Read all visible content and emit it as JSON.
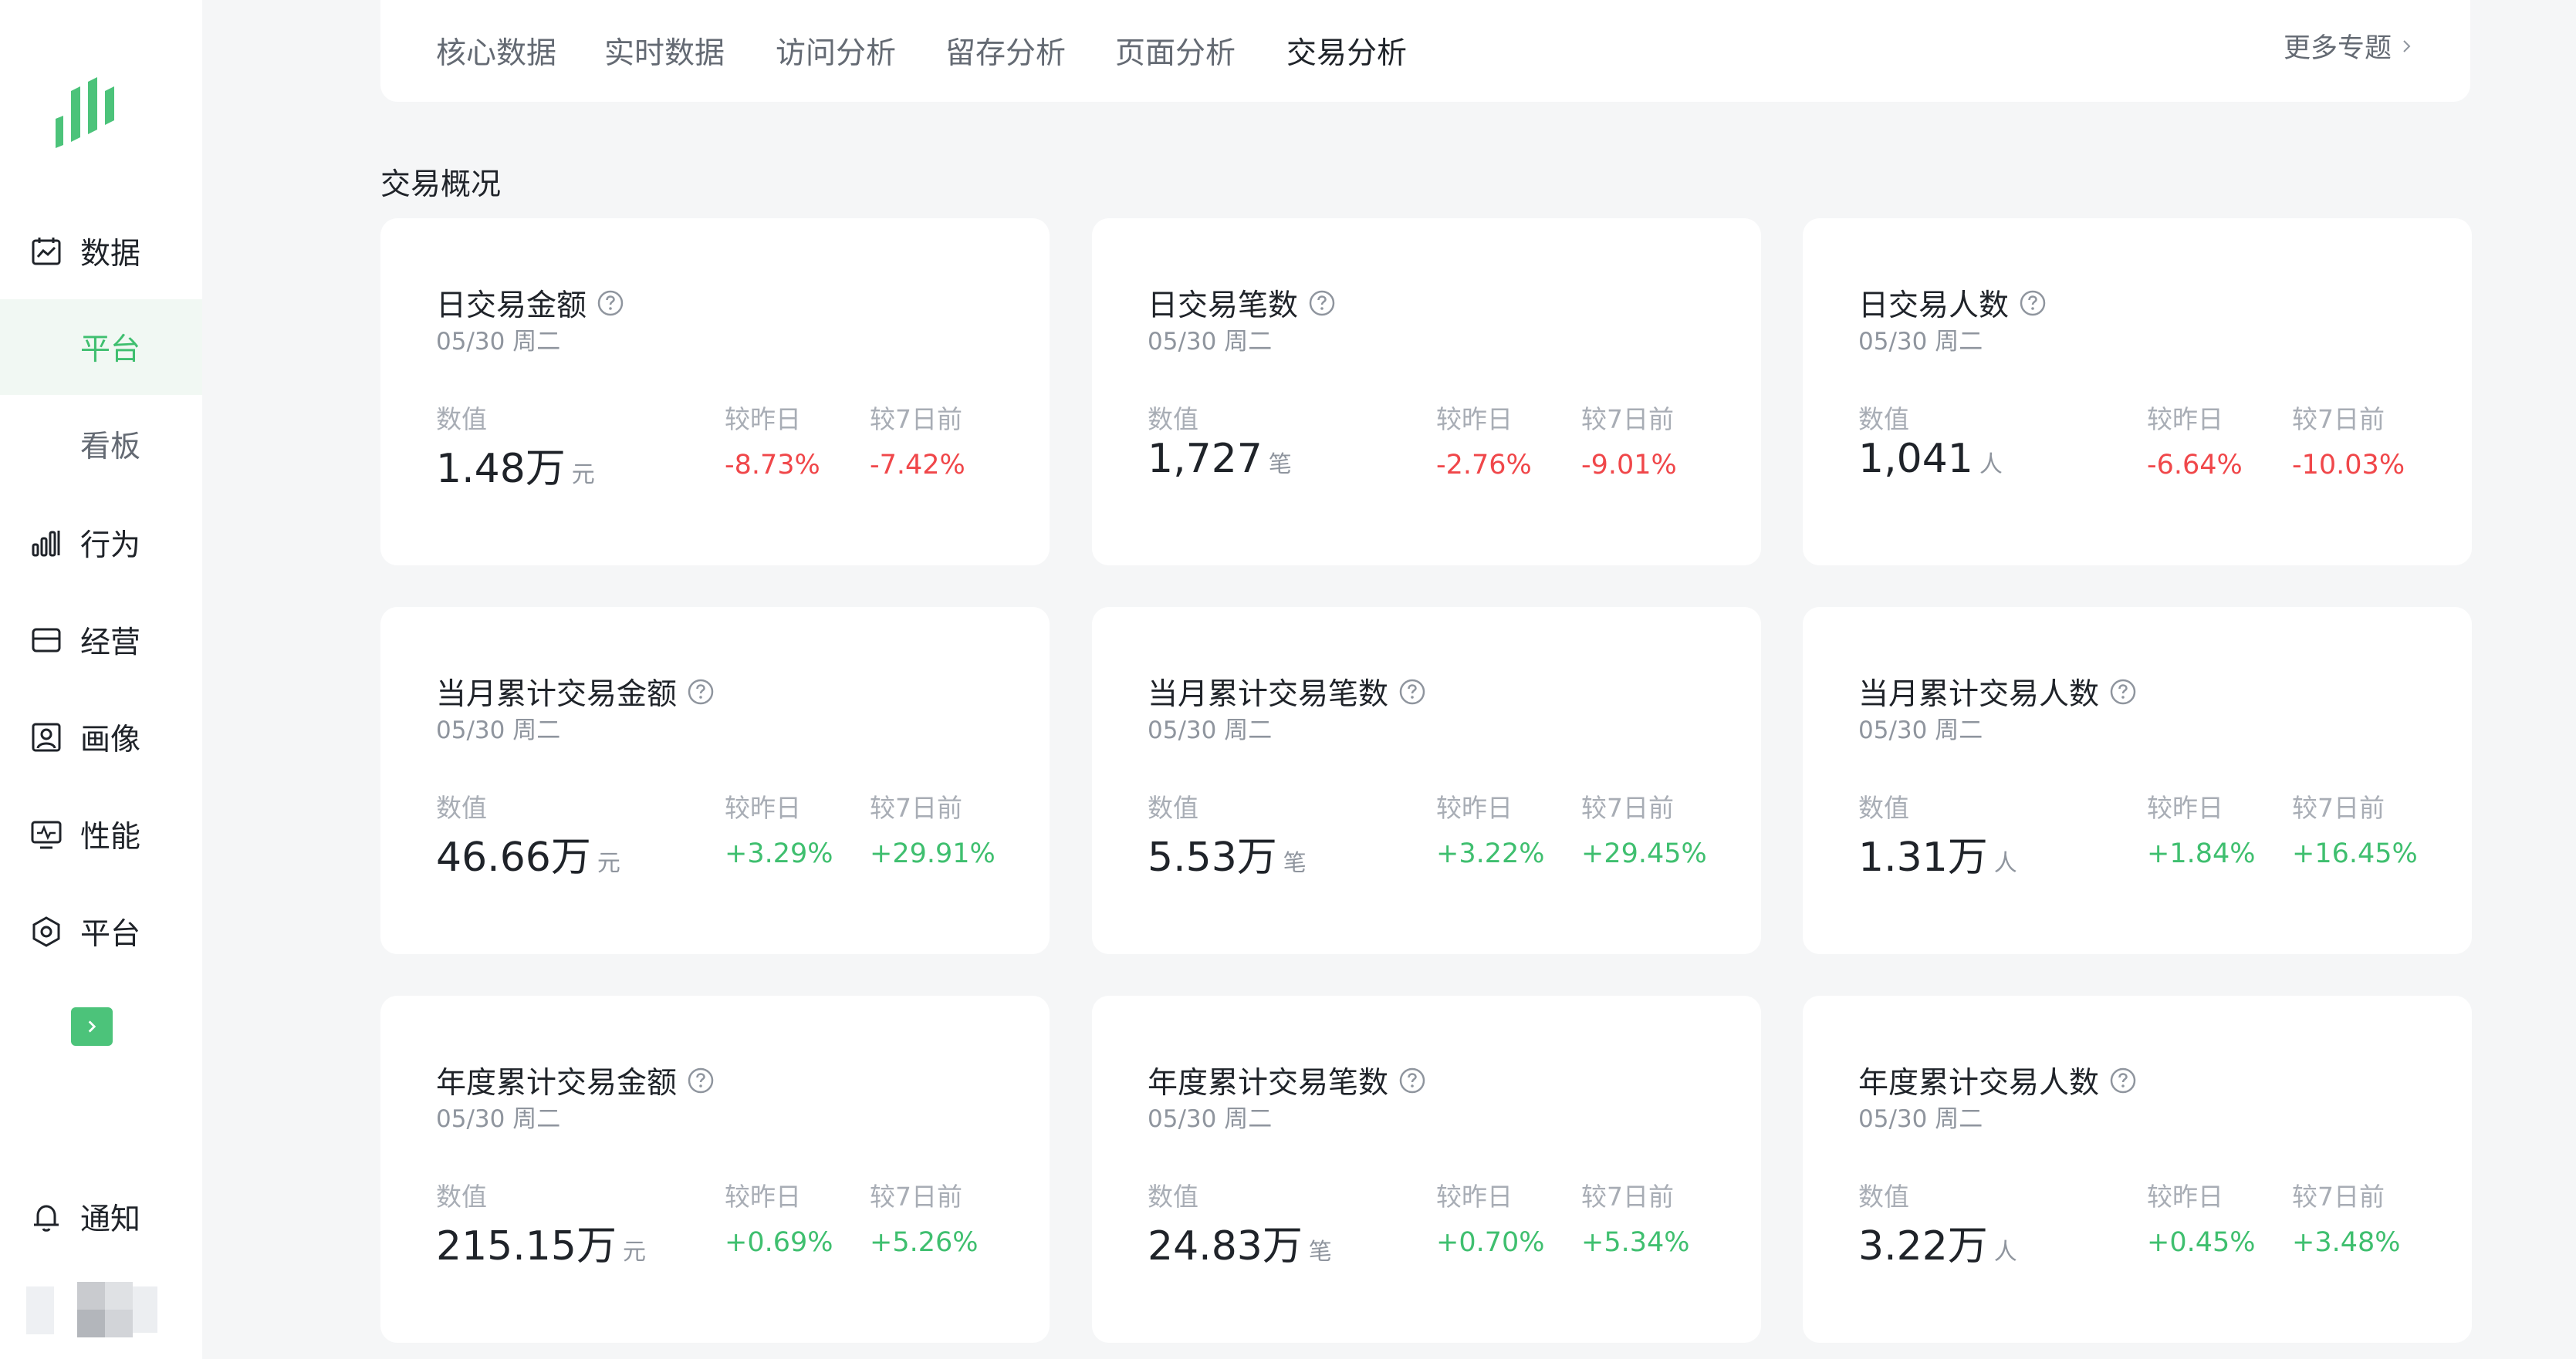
{
  "sidebar": {
    "sections": [
      {
        "icon": "calendar-chart-icon",
        "label": "数据"
      },
      {
        "icon": "bar-chart-icon",
        "label": "行为"
      },
      {
        "icon": "store-icon",
        "label": "经营"
      },
      {
        "icon": "portrait-icon",
        "label": "画像"
      },
      {
        "icon": "monitor-pulse-icon",
        "label": "性能"
      },
      {
        "icon": "hexagon-icon",
        "label": "平台"
      }
    ],
    "sub_items": [
      {
        "label": "平台",
        "active": true
      },
      {
        "label": "看板",
        "active": false
      }
    ],
    "notifications_label": "通知",
    "accent_color": "#3fbf6f"
  },
  "tabs": [
    {
      "label": "核心数据",
      "active": false
    },
    {
      "label": "实时数据",
      "active": false
    },
    {
      "label": "访问分析",
      "active": false
    },
    {
      "label": "留存分析",
      "active": false
    },
    {
      "label": "页面分析",
      "active": false
    },
    {
      "label": "交易分析",
      "active": true
    }
  ],
  "more_topics": "更多专题",
  "section_title": "交易概况",
  "labels": {
    "value": "数值",
    "day_over_day": "较昨日",
    "week_over_week": "较7日前"
  },
  "cards": [
    {
      "title": "日交易金额",
      "date": "05/30 周二",
      "value": "1.48万",
      "unit": "元",
      "dod": "-8.73%",
      "wow": "-7.42%"
    },
    {
      "title": "日交易笔数",
      "date": "05/30 周二",
      "value": "1,727",
      "unit": "笔",
      "dod": "-2.76%",
      "wow": "-9.01%"
    },
    {
      "title": "日交易人数",
      "date": "05/30 周二",
      "value": "1,041",
      "unit": "人",
      "dod": "-6.64%",
      "wow": "-10.03%"
    },
    {
      "title": "当月累计交易金额",
      "date": "05/30 周二",
      "value": "46.66万",
      "unit": "元",
      "dod": "+3.29%",
      "wow": "+29.91%"
    },
    {
      "title": "当月累计交易笔数",
      "date": "05/30 周二",
      "value": "5.53万",
      "unit": "笔",
      "dod": "+3.22%",
      "wow": "+29.45%"
    },
    {
      "title": "当月累计交易人数",
      "date": "05/30 周二",
      "value": "1.31万",
      "unit": "人",
      "dod": "+1.84%",
      "wow": "+16.45%"
    },
    {
      "title": "年度累计交易金额",
      "date": "05/30 周二",
      "value": "215.15万",
      "unit": "元",
      "dod": "+0.69%",
      "wow": "+5.26%"
    },
    {
      "title": "年度累计交易笔数",
      "date": "05/30 周二",
      "value": "24.83万",
      "unit": "笔",
      "dod": "+0.70%",
      "wow": "+5.34%"
    },
    {
      "title": "年度累计交易人数",
      "date": "05/30 周二",
      "value": "3.22万",
      "unit": "人",
      "dod": "+0.45%",
      "wow": "+3.48%"
    }
  ],
  "colors": {
    "negative": "#f0474a",
    "positive": "#3fbf6f"
  }
}
